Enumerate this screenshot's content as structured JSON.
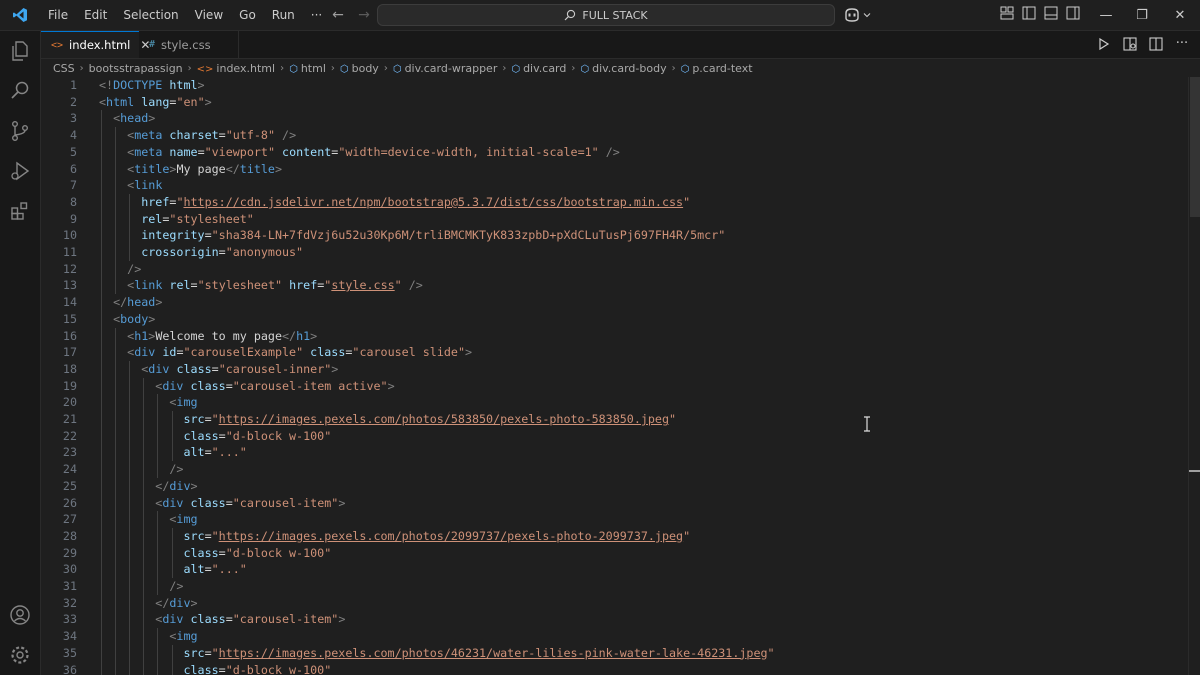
{
  "menu": [
    "File",
    "Edit",
    "Selection",
    "View",
    "Go",
    "Run",
    "···"
  ],
  "command_center": {
    "label": "FULL STACK"
  },
  "window_controls": {
    "minimize": "—",
    "restore": "❐",
    "close": "✕"
  },
  "tabs": [
    {
      "label": "index.html",
      "icon": "<>",
      "active": true,
      "close": "✕"
    },
    {
      "label": "style.css",
      "icon": "#",
      "active": false
    }
  ],
  "breadcrumb": [
    {
      "label": "CSS",
      "icon": ""
    },
    {
      "label": "bootsstrapassign",
      "icon": ""
    },
    {
      "label": "index.html",
      "icon": "<>"
    },
    {
      "label": "html",
      "icon": "⬡"
    },
    {
      "label": "body",
      "icon": "⬡"
    },
    {
      "label": "div.card-wrapper",
      "icon": "⬡"
    },
    {
      "label": "div.card",
      "icon": "⬡"
    },
    {
      "label": "div.card-body",
      "icon": "⬡"
    },
    {
      "label": "p.card-text",
      "icon": "⬡"
    }
  ],
  "code_lines": [
    {
      "n": "1",
      "t": [
        [
          "p",
          "<!"
        ],
        [
          "g",
          "DOCTYPE"
        ],
        [
          "x",
          " "
        ],
        [
          "a",
          "html"
        ],
        [
          "p",
          ">"
        ]
      ]
    },
    {
      "n": "2",
      "t": [
        [
          "p",
          "<"
        ],
        [
          "g",
          "html"
        ],
        [
          "x",
          " "
        ],
        [
          "a",
          "lang"
        ],
        [
          "x",
          "="
        ],
        [
          "s",
          "\"en\""
        ],
        [
          "p",
          ">"
        ]
      ]
    },
    {
      "n": "3",
      "t": [
        [
          "x",
          "  "
        ],
        [
          "p",
          "<"
        ],
        [
          "g",
          "head"
        ],
        [
          "p",
          ">"
        ]
      ]
    },
    {
      "n": "4",
      "t": [
        [
          "x",
          "    "
        ],
        [
          "p",
          "<"
        ],
        [
          "g",
          "meta"
        ],
        [
          "x",
          " "
        ],
        [
          "a",
          "charset"
        ],
        [
          "x",
          "="
        ],
        [
          "s",
          "\"utf-8\""
        ],
        [
          "x",
          " "
        ],
        [
          "p",
          "/>"
        ]
      ]
    },
    {
      "n": "5",
      "t": [
        [
          "x",
          "    "
        ],
        [
          "p",
          "<"
        ],
        [
          "g",
          "meta"
        ],
        [
          "x",
          " "
        ],
        [
          "a",
          "name"
        ],
        [
          "x",
          "="
        ],
        [
          "s",
          "\"viewport\""
        ],
        [
          "x",
          " "
        ],
        [
          "a",
          "content"
        ],
        [
          "x",
          "="
        ],
        [
          "s",
          "\"width=device-width, initial-scale=1\""
        ],
        [
          "x",
          " "
        ],
        [
          "p",
          "/>"
        ]
      ]
    },
    {
      "n": "6",
      "t": [
        [
          "x",
          "    "
        ],
        [
          "p",
          "<"
        ],
        [
          "g",
          "title"
        ],
        [
          "p",
          ">"
        ],
        [
          "x",
          "My page"
        ],
        [
          "p",
          "</"
        ],
        [
          "g",
          "title"
        ],
        [
          "p",
          ">"
        ]
      ]
    },
    {
      "n": "7",
      "t": [
        [
          "x",
          "    "
        ],
        [
          "p",
          "<"
        ],
        [
          "g",
          "link"
        ]
      ]
    },
    {
      "n": "8",
      "t": [
        [
          "x",
          "      "
        ],
        [
          "a",
          "href"
        ],
        [
          "x",
          "="
        ],
        [
          "s",
          "\""
        ],
        [
          "l",
          "https://cdn.jsdelivr.net/npm/bootstrap@5.3.7/dist/css/bootstrap.min.css"
        ],
        [
          "s",
          "\""
        ]
      ]
    },
    {
      "n": "9",
      "t": [
        [
          "x",
          "      "
        ],
        [
          "a",
          "rel"
        ],
        [
          "x",
          "="
        ],
        [
          "s",
          "\"stylesheet\""
        ]
      ]
    },
    {
      "n": "10",
      "t": [
        [
          "x",
          "      "
        ],
        [
          "a",
          "integrity"
        ],
        [
          "x",
          "="
        ],
        [
          "s",
          "\"sha384-LN+7fdVzj6u52u30Kp6M/trliBMCMKTyK833zpbD+pXdCLuTusPj697FH4R/5mcr\""
        ]
      ]
    },
    {
      "n": "11",
      "t": [
        [
          "x",
          "      "
        ],
        [
          "a",
          "crossorigin"
        ],
        [
          "x",
          "="
        ],
        [
          "s",
          "\"anonymous\""
        ]
      ]
    },
    {
      "n": "12",
      "t": [
        [
          "x",
          "    "
        ],
        [
          "p",
          "/>"
        ]
      ]
    },
    {
      "n": "13",
      "t": [
        [
          "x",
          "    "
        ],
        [
          "p",
          "<"
        ],
        [
          "g",
          "link"
        ],
        [
          "x",
          " "
        ],
        [
          "a",
          "rel"
        ],
        [
          "x",
          "="
        ],
        [
          "s",
          "\"stylesheet\""
        ],
        [
          "x",
          " "
        ],
        [
          "a",
          "href"
        ],
        [
          "x",
          "="
        ],
        [
          "s",
          "\""
        ],
        [
          "l",
          "style.css"
        ],
        [
          "s",
          "\""
        ],
        [
          "x",
          " "
        ],
        [
          "p",
          "/>"
        ]
      ]
    },
    {
      "n": "14",
      "t": [
        [
          "x",
          "  "
        ],
        [
          "p",
          "</"
        ],
        [
          "g",
          "head"
        ],
        [
          "p",
          ">"
        ]
      ]
    },
    {
      "n": "15",
      "t": [
        [
          "x",
          "  "
        ],
        [
          "p",
          "<"
        ],
        [
          "g",
          "body"
        ],
        [
          "p",
          ">"
        ]
      ]
    },
    {
      "n": "16",
      "t": [
        [
          "x",
          "    "
        ],
        [
          "p",
          "<"
        ],
        [
          "g",
          "h1"
        ],
        [
          "p",
          ">"
        ],
        [
          "x",
          "Welcome to my page"
        ],
        [
          "p",
          "</"
        ],
        [
          "g",
          "h1"
        ],
        [
          "p",
          ">"
        ]
      ]
    },
    {
      "n": "17",
      "t": [
        [
          "x",
          "    "
        ],
        [
          "p",
          "<"
        ],
        [
          "g",
          "div"
        ],
        [
          "x",
          " "
        ],
        [
          "a",
          "id"
        ],
        [
          "x",
          "="
        ],
        [
          "s",
          "\"carouselExample\""
        ],
        [
          "x",
          " "
        ],
        [
          "a",
          "class"
        ],
        [
          "x",
          "="
        ],
        [
          "s",
          "\"carousel slide\""
        ],
        [
          "p",
          ">"
        ]
      ]
    },
    {
      "n": "18",
      "t": [
        [
          "x",
          "      "
        ],
        [
          "p",
          "<"
        ],
        [
          "g",
          "div"
        ],
        [
          "x",
          " "
        ],
        [
          "a",
          "class"
        ],
        [
          "x",
          "="
        ],
        [
          "s",
          "\"carousel-inner\""
        ],
        [
          "p",
          ">"
        ]
      ]
    },
    {
      "n": "19",
      "t": [
        [
          "x",
          "        "
        ],
        [
          "p",
          "<"
        ],
        [
          "g",
          "div"
        ],
        [
          "x",
          " "
        ],
        [
          "a",
          "class"
        ],
        [
          "x",
          "="
        ],
        [
          "s",
          "\"carousel-item active\""
        ],
        [
          "p",
          ">"
        ]
      ]
    },
    {
      "n": "20",
      "t": [
        [
          "x",
          "          "
        ],
        [
          "p",
          "<"
        ],
        [
          "g",
          "img"
        ]
      ]
    },
    {
      "n": "21",
      "t": [
        [
          "x",
          "            "
        ],
        [
          "a",
          "src"
        ],
        [
          "x",
          "="
        ],
        [
          "s",
          "\""
        ],
        [
          "l",
          "https://images.pexels.com/photos/583850/pexels-photo-583850.jpeg"
        ],
        [
          "s",
          "\""
        ]
      ]
    },
    {
      "n": "22",
      "t": [
        [
          "x",
          "            "
        ],
        [
          "a",
          "class"
        ],
        [
          "x",
          "="
        ],
        [
          "s",
          "\"d-block w-100\""
        ]
      ]
    },
    {
      "n": "23",
      "t": [
        [
          "x",
          "            "
        ],
        [
          "a",
          "alt"
        ],
        [
          "x",
          "="
        ],
        [
          "s",
          "\"...\""
        ]
      ]
    },
    {
      "n": "24",
      "t": [
        [
          "x",
          "          "
        ],
        [
          "p",
          "/>"
        ]
      ]
    },
    {
      "n": "25",
      "t": [
        [
          "x",
          "        "
        ],
        [
          "p",
          "</"
        ],
        [
          "g",
          "div"
        ],
        [
          "p",
          ">"
        ]
      ]
    },
    {
      "n": "26",
      "t": [
        [
          "x",
          "        "
        ],
        [
          "p",
          "<"
        ],
        [
          "g",
          "div"
        ],
        [
          "x",
          " "
        ],
        [
          "a",
          "class"
        ],
        [
          "x",
          "="
        ],
        [
          "s",
          "\"carousel-item\""
        ],
        [
          "p",
          ">"
        ]
      ]
    },
    {
      "n": "27",
      "t": [
        [
          "x",
          "          "
        ],
        [
          "p",
          "<"
        ],
        [
          "g",
          "img"
        ]
      ]
    },
    {
      "n": "28",
      "t": [
        [
          "x",
          "            "
        ],
        [
          "a",
          "src"
        ],
        [
          "x",
          "="
        ],
        [
          "s",
          "\""
        ],
        [
          "l",
          "https://images.pexels.com/photos/2099737/pexels-photo-2099737.jpeg"
        ],
        [
          "s",
          "\""
        ]
      ]
    },
    {
      "n": "29",
      "t": [
        [
          "x",
          "            "
        ],
        [
          "a",
          "class"
        ],
        [
          "x",
          "="
        ],
        [
          "s",
          "\"d-block w-100\""
        ]
      ]
    },
    {
      "n": "30",
      "t": [
        [
          "x",
          "            "
        ],
        [
          "a",
          "alt"
        ],
        [
          "x",
          "="
        ],
        [
          "s",
          "\"...\""
        ]
      ]
    },
    {
      "n": "31",
      "t": [
        [
          "x",
          "          "
        ],
        [
          "p",
          "/>"
        ]
      ]
    },
    {
      "n": "32",
      "t": [
        [
          "x",
          "        "
        ],
        [
          "p",
          "</"
        ],
        [
          "g",
          "div"
        ],
        [
          "p",
          ">"
        ]
      ]
    },
    {
      "n": "33",
      "t": [
        [
          "x",
          "        "
        ],
        [
          "p",
          "<"
        ],
        [
          "g",
          "div"
        ],
        [
          "x",
          " "
        ],
        [
          "a",
          "class"
        ],
        [
          "x",
          "="
        ],
        [
          "s",
          "\"carousel-item\""
        ],
        [
          "p",
          ">"
        ]
      ]
    },
    {
      "n": "34",
      "t": [
        [
          "x",
          "          "
        ],
        [
          "p",
          "<"
        ],
        [
          "g",
          "img"
        ]
      ]
    },
    {
      "n": "35",
      "t": [
        [
          "x",
          "            "
        ],
        [
          "a",
          "src"
        ],
        [
          "x",
          "="
        ],
        [
          "s",
          "\""
        ],
        [
          "l",
          "https://images.pexels.com/photos/46231/water-lilies-pink-water-lake-46231.jpeg"
        ],
        [
          "s",
          "\""
        ]
      ]
    },
    {
      "n": "36",
      "t": [
        [
          "x",
          "            "
        ],
        [
          "a",
          "class"
        ],
        [
          "x",
          "="
        ],
        [
          "s",
          "\"d-block w-100\""
        ]
      ]
    }
  ]
}
